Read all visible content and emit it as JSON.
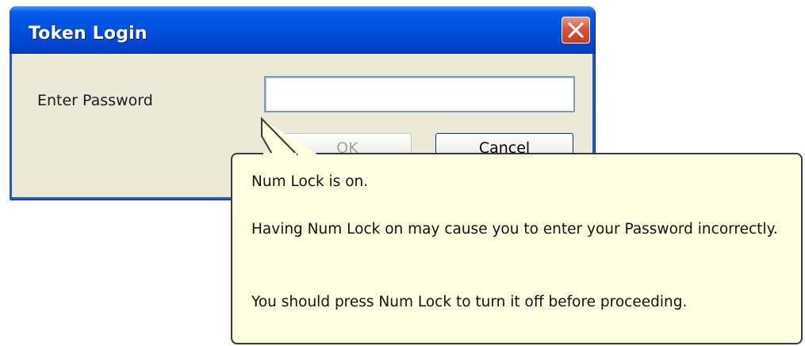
{
  "window": {
    "title": "Token Login",
    "close_icon": "close-icon"
  },
  "form": {
    "password_label": "Enter Password",
    "password_value": "",
    "ok_label": "OK",
    "cancel_label": "Cancel"
  },
  "balloon": {
    "heading": "Num Lock is on.",
    "message": "Having Num Lock on may cause you to enter your Password incorrectly.",
    "advice": "You should press Num Lock to turn it off before proceeding."
  },
  "colors": {
    "titlebar": "#0054e3",
    "window_face": "#ece9d8",
    "close_button": "#d8553a",
    "balloon_background": "#ffffe1"
  }
}
